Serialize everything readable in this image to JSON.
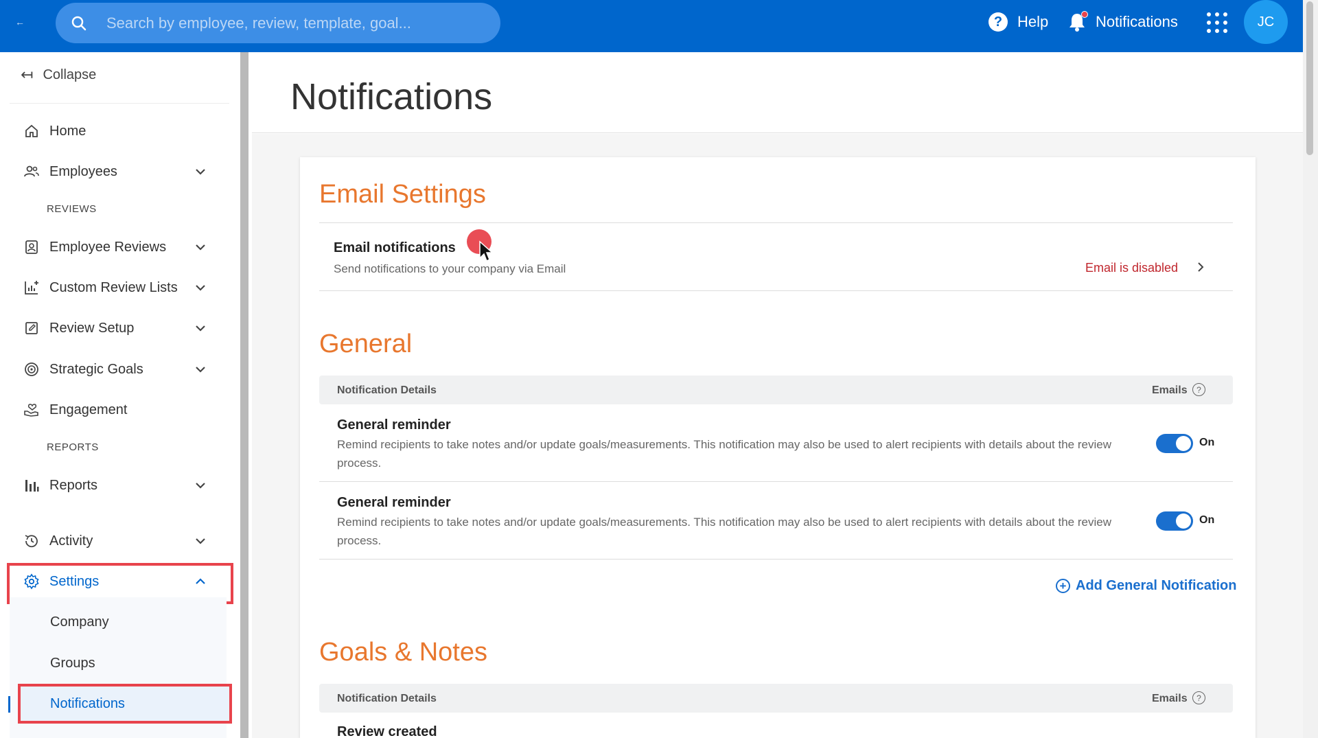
{
  "topbar": {
    "back_label": "←",
    "search_placeholder": "Search by employee, review, template, goal...",
    "help_label": "Help",
    "notifications_label": "Notifications",
    "avatar_initials": "JC",
    "colors": {
      "bar": "#0066cc",
      "search": "#3d8ee6",
      "avatar": "#1e9bef",
      "badge": "#e8434c"
    },
    "icons": [
      "search-icon",
      "help-icon",
      "bell-icon",
      "apps-grid-icon"
    ]
  },
  "sidebar": {
    "collapse_label": "Collapse",
    "items": [
      {
        "label": "Home",
        "icon": "home-icon"
      },
      {
        "label": "Employees",
        "icon": "people-icon"
      },
      {
        "label": "REVIEWS"
      },
      {
        "label": "Employee Reviews",
        "icon": "review-badge-icon"
      },
      {
        "label": "Custom Review Lists",
        "icon": "chart-plus-icon"
      },
      {
        "label": "Review Setup",
        "icon": "edit-square-icon"
      },
      {
        "label": "Strategic Goals",
        "icon": "target-icon"
      },
      {
        "label": "Engagement",
        "icon": "hand-heart-icon"
      },
      {
        "label": "REPORTS"
      },
      {
        "label": "Reports",
        "icon": "bar-chart-icon"
      },
      {
        "label": "Activity",
        "icon": "history-icon"
      },
      {
        "label": "Settings",
        "icon": "gear-icon"
      }
    ],
    "settings_sub": [
      {
        "label": "Company"
      },
      {
        "label": "Groups"
      },
      {
        "label": "Notifications"
      }
    ],
    "highlight_color": "#e8434c",
    "active_color": "#0066cc"
  },
  "main": {
    "page_title": "Notifications",
    "email_settings": {
      "title": "Email Settings",
      "row_title": "Email notifications",
      "row_desc": "Send notifications to your company via Email",
      "status": "Email is disabled",
      "status_color": "#c0262d"
    },
    "general": {
      "title": "General",
      "col_details": "Notification Details",
      "col_emails": "Emails",
      "rows": [
        {
          "title": "General reminder",
          "desc_line1": "Remind recipients to take notes and/or update goals/measurements. This notification may also be used to alert recipients with details about the review",
          "desc_line2": "process.",
          "toggle_label": "On"
        },
        {
          "title": "General reminder",
          "desc_line1": "Remind recipients to take notes and/or update goals/measurements. This notification may also be used to alert recipients with details about the review",
          "desc_line2": "process.",
          "toggle_label": "On"
        }
      ],
      "add_label": "Add General Notification"
    },
    "goals_notes": {
      "title": "Goals & Notes",
      "col_details": "Notification Details",
      "col_emails": "Emails",
      "first_row_title": "Review created"
    },
    "accent_color": "#e8772e",
    "link_color": "#1a6fce"
  }
}
